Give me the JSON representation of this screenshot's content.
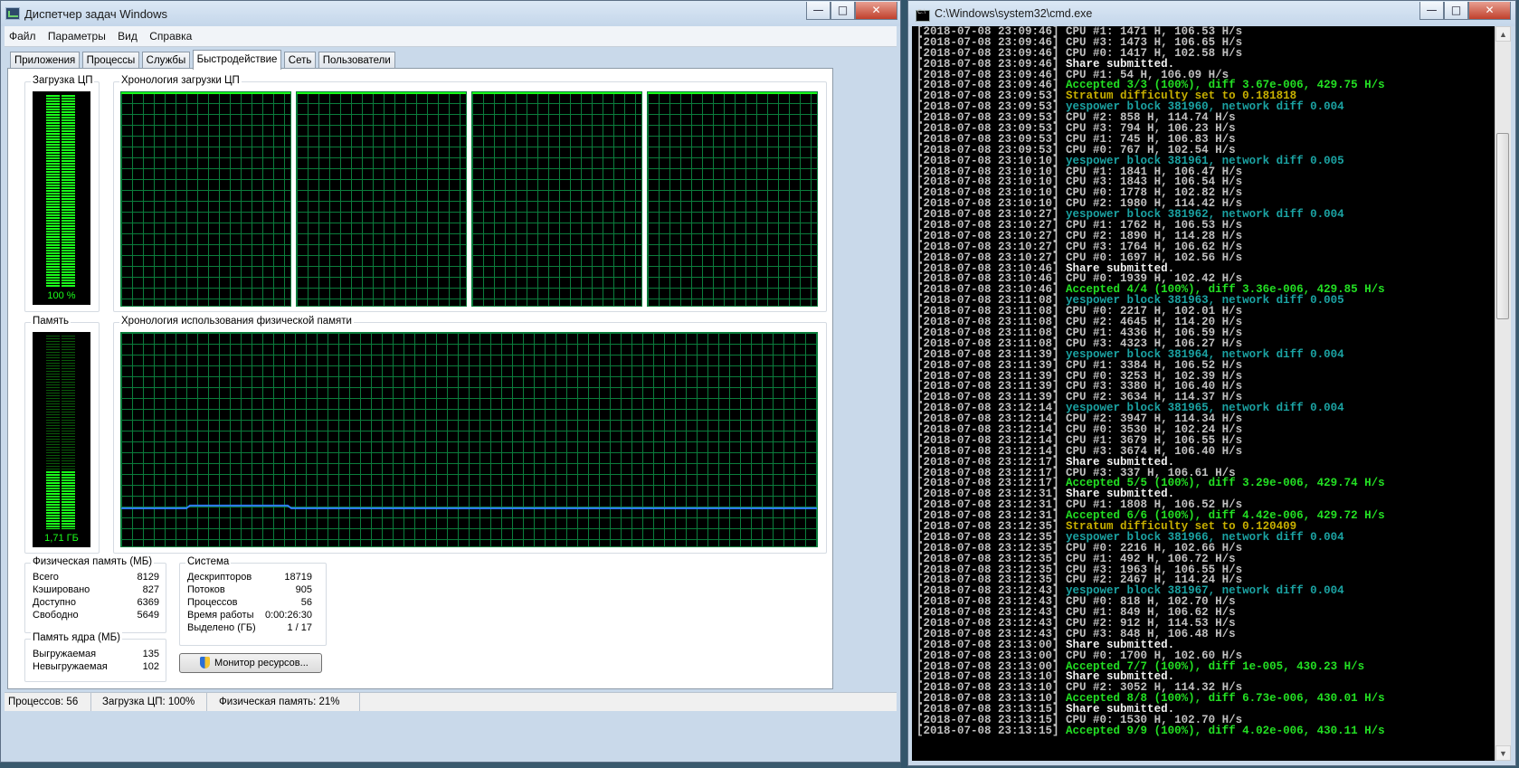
{
  "taskmanager": {
    "title": "Диспетчер задач Windows",
    "controls": {
      "minimize": "—",
      "maximize": "□",
      "close": "✕"
    },
    "menu": [
      "Файл",
      "Параметры",
      "Вид",
      "Справка"
    ],
    "tabs": [
      "Приложения",
      "Процессы",
      "Службы",
      "Быстродействие",
      "Сеть",
      "Пользователи"
    ],
    "active_tab": "Быстродействие",
    "cpu_usage": {
      "label": "Загрузка ЦП",
      "value_text": "100 %",
      "level": 1.0
    },
    "cpu_history": {
      "label": "Хронология загрузки ЦП",
      "cores": 4,
      "values_percent": [
        100,
        100,
        100,
        100
      ]
    },
    "memory": {
      "label": "Память",
      "value_text": "1,71 ГБ",
      "level": 0.21
    },
    "memory_history": {
      "label": "Хронология использования физической памяти",
      "level_percent": 21
    },
    "physical_memory": {
      "title": "Физическая память (МБ)",
      "rows": [
        {
          "label": "Всего",
          "value": "8129"
        },
        {
          "label": "Кэшировано",
          "value": "827"
        },
        {
          "label": "Доступно",
          "value": "6369"
        },
        {
          "label": "Свободно",
          "value": "5649"
        }
      ]
    },
    "kernel_memory": {
      "title": "Память ядра (МБ)",
      "rows": [
        {
          "label": "Выгружаемая",
          "value": "135"
        },
        {
          "label": "Невыгружаемая",
          "value": "102"
        }
      ]
    },
    "system": {
      "title": "Система",
      "rows": [
        {
          "label": "Дескрипторов",
          "value": "18719"
        },
        {
          "label": "Потоков",
          "value": "905"
        },
        {
          "label": "Процессов",
          "value": "56"
        },
        {
          "label": "Время работы",
          "value": "0:00:26:30"
        },
        {
          "label": "Выделено (ГБ)",
          "value": "1 / 17"
        }
      ]
    },
    "resource_monitor_button": "Монитор ресурсов...",
    "statusbar": {
      "processes": "Процессов: 56",
      "cpu": "Загрузка ЦП: 100%",
      "memory": "Физическая память: 21%"
    }
  },
  "cmd": {
    "title": "C:\\Windows\\system32\\cmd.exe",
    "lines": [
      {
        "ts": "[2018-07-08 23:09:46]",
        "msg": "CPU #1: 1471 H, 106.53 H/s",
        "type": "normal"
      },
      {
        "ts": "[2018-07-08 23:09:46]",
        "msg": "CPU #3: 1473 H, 106.65 H/s",
        "type": "normal"
      },
      {
        "ts": "[2018-07-08 23:09:46]",
        "msg": "CPU #0: 1417 H, 102.58 H/s",
        "type": "normal"
      },
      {
        "ts": "[2018-07-08 23:09:46]",
        "msg": "Share submitted.",
        "type": "white"
      },
      {
        "ts": "[2018-07-08 23:09:46]",
        "msg": "CPU #1: 54 H, 106.09 H/s",
        "type": "normal"
      },
      {
        "ts": "[2018-07-08 23:09:46]",
        "msg": "Accepted 3/3 (100%), diff 3.67e-006, 429.75 H/s",
        "type": "accepted"
      },
      {
        "ts": "[2018-07-08 23:09:53]",
        "msg": "Stratum difficulty set to 0.181818",
        "type": "stratum"
      },
      {
        "ts": "[2018-07-08 23:09:53]",
        "msg": "yespower block 381960, network diff 0.004",
        "type": "block"
      },
      {
        "ts": "[2018-07-08 23:09:53]",
        "msg": "CPU #2: 858 H, 114.74 H/s",
        "type": "normal"
      },
      {
        "ts": "[2018-07-08 23:09:53]",
        "msg": "CPU #3: 794 H, 106.23 H/s",
        "type": "normal"
      },
      {
        "ts": "[2018-07-08 23:09:53]",
        "msg": "CPU #1: 745 H, 106.83 H/s",
        "type": "normal"
      },
      {
        "ts": "[2018-07-08 23:09:53]",
        "msg": "CPU #0: 767 H, 102.54 H/s",
        "type": "normal"
      },
      {
        "ts": "[2018-07-08 23:10:10]",
        "msg": "yespower block 381961, network diff 0.005",
        "type": "block"
      },
      {
        "ts": "[2018-07-08 23:10:10]",
        "msg": "CPU #1: 1841 H, 106.47 H/s",
        "type": "normal"
      },
      {
        "ts": "[2018-07-08 23:10:10]",
        "msg": "CPU #3: 1843 H, 106.54 H/s",
        "type": "normal"
      },
      {
        "ts": "[2018-07-08 23:10:10]",
        "msg": "CPU #0: 1778 H, 102.82 H/s",
        "type": "normal"
      },
      {
        "ts": "[2018-07-08 23:10:10]",
        "msg": "CPU #2: 1980 H, 114.42 H/s",
        "type": "normal"
      },
      {
        "ts": "[2018-07-08 23:10:27]",
        "msg": "yespower block 381962, network diff 0.004",
        "type": "block"
      },
      {
        "ts": "[2018-07-08 23:10:27]",
        "msg": "CPU #1: 1762 H, 106.53 H/s",
        "type": "normal"
      },
      {
        "ts": "[2018-07-08 23:10:27]",
        "msg": "CPU #2: 1890 H, 114.28 H/s",
        "type": "normal"
      },
      {
        "ts": "[2018-07-08 23:10:27]",
        "msg": "CPU #3: 1764 H, 106.62 H/s",
        "type": "normal"
      },
      {
        "ts": "[2018-07-08 23:10:27]",
        "msg": "CPU #0: 1697 H, 102.56 H/s",
        "type": "normal"
      },
      {
        "ts": "[2018-07-08 23:10:46]",
        "msg": "Share submitted.",
        "type": "white"
      },
      {
        "ts": "[2018-07-08 23:10:46]",
        "msg": "CPU #0: 1939 H, 102.42 H/s",
        "type": "normal"
      },
      {
        "ts": "[2018-07-08 23:10:46]",
        "msg": "Accepted 4/4 (100%), diff 3.36e-006, 429.85 H/s",
        "type": "accepted"
      },
      {
        "ts": "[2018-07-08 23:11:08]",
        "msg": "yespower block 381963, network diff 0.005",
        "type": "block"
      },
      {
        "ts": "[2018-07-08 23:11:08]",
        "msg": "CPU #0: 2217 H, 102.01 H/s",
        "type": "normal"
      },
      {
        "ts": "[2018-07-08 23:11:08]",
        "msg": "CPU #2: 4645 H, 114.20 H/s",
        "type": "normal"
      },
      {
        "ts": "[2018-07-08 23:11:08]",
        "msg": "CPU #1: 4336 H, 106.59 H/s",
        "type": "normal"
      },
      {
        "ts": "[2018-07-08 23:11:08]",
        "msg": "CPU #3: 4323 H, 106.27 H/s",
        "type": "normal"
      },
      {
        "ts": "[2018-07-08 23:11:39]",
        "msg": "yespower block 381964, network diff 0.004",
        "type": "block"
      },
      {
        "ts": "[2018-07-08 23:11:39]",
        "msg": "CPU #1: 3384 H, 106.52 H/s",
        "type": "normal"
      },
      {
        "ts": "[2018-07-08 23:11:39]",
        "msg": "CPU #0: 3253 H, 102.39 H/s",
        "type": "normal"
      },
      {
        "ts": "[2018-07-08 23:11:39]",
        "msg": "CPU #3: 3380 H, 106.40 H/s",
        "type": "normal"
      },
      {
        "ts": "[2018-07-08 23:11:39]",
        "msg": "CPU #2: 3634 H, 114.37 H/s",
        "type": "normal"
      },
      {
        "ts": "[2018-07-08 23:12:14]",
        "msg": "yespower block 381965, network diff 0.004",
        "type": "block"
      },
      {
        "ts": "[2018-07-08 23:12:14]",
        "msg": "CPU #2: 3947 H, 114.34 H/s",
        "type": "normal"
      },
      {
        "ts": "[2018-07-08 23:12:14]",
        "msg": "CPU #0: 3530 H, 102.24 H/s",
        "type": "normal"
      },
      {
        "ts": "[2018-07-08 23:12:14]",
        "msg": "CPU #1: 3679 H, 106.55 H/s",
        "type": "normal"
      },
      {
        "ts": "[2018-07-08 23:12:14]",
        "msg": "CPU #3: 3674 H, 106.40 H/s",
        "type": "normal"
      },
      {
        "ts": "[2018-07-08 23:12:17]",
        "msg": "Share submitted.",
        "type": "white"
      },
      {
        "ts": "[2018-07-08 23:12:17]",
        "msg": "CPU #3: 337 H, 106.61 H/s",
        "type": "normal"
      },
      {
        "ts": "[2018-07-08 23:12:17]",
        "msg": "Accepted 5/5 (100%), diff 3.29e-006, 429.74 H/s",
        "type": "accepted"
      },
      {
        "ts": "[2018-07-08 23:12:31]",
        "msg": "Share submitted.",
        "type": "white"
      },
      {
        "ts": "[2018-07-08 23:12:31]",
        "msg": "CPU #1: 1808 H, 106.52 H/s",
        "type": "normal"
      },
      {
        "ts": "[2018-07-08 23:12:31]",
        "msg": "Accepted 6/6 (100%), diff 4.42e-006, 429.72 H/s",
        "type": "accepted"
      },
      {
        "ts": "[2018-07-08 23:12:35]",
        "msg": "Stratum difficulty set to 0.120409",
        "type": "stratum"
      },
      {
        "ts": "[2018-07-08 23:12:35]",
        "msg": "yespower block 381966, network diff 0.004",
        "type": "block"
      },
      {
        "ts": "[2018-07-08 23:12:35]",
        "msg": "CPU #0: 2216 H, 102.66 H/s",
        "type": "normal"
      },
      {
        "ts": "[2018-07-08 23:12:35]",
        "msg": "CPU #1: 492 H, 106.72 H/s",
        "type": "normal"
      },
      {
        "ts": "[2018-07-08 23:12:35]",
        "msg": "CPU #3: 1963 H, 106.55 H/s",
        "type": "normal"
      },
      {
        "ts": "[2018-07-08 23:12:35]",
        "msg": "CPU #2: 2467 H, 114.24 H/s",
        "type": "normal"
      },
      {
        "ts": "[2018-07-08 23:12:43]",
        "msg": "yespower block 381967, network diff 0.004",
        "type": "block"
      },
      {
        "ts": "[2018-07-08 23:12:43]",
        "msg": "CPU #0: 818 H, 102.70 H/s",
        "type": "normal"
      },
      {
        "ts": "[2018-07-08 23:12:43]",
        "msg": "CPU #1: 849 H, 106.62 H/s",
        "type": "normal"
      },
      {
        "ts": "[2018-07-08 23:12:43]",
        "msg": "CPU #2: 912 H, 114.53 H/s",
        "type": "normal"
      },
      {
        "ts": "[2018-07-08 23:12:43]",
        "msg": "CPU #3: 848 H, 106.48 H/s",
        "type": "normal"
      },
      {
        "ts": "[2018-07-08 23:13:00]",
        "msg": "Share submitted.",
        "type": "white"
      },
      {
        "ts": "[2018-07-08 23:13:00]",
        "msg": "CPU #0: 1700 H, 102.60 H/s",
        "type": "normal"
      },
      {
        "ts": "[2018-07-08 23:13:00]",
        "msg": "Accepted 7/7 (100%), diff 1e-005, 430.23 H/s",
        "type": "accepted"
      },
      {
        "ts": "[2018-07-08 23:13:10]",
        "msg": "Share submitted.",
        "type": "white"
      },
      {
        "ts": "[2018-07-08 23:13:10]",
        "msg": "CPU #2: 3052 H, 114.32 H/s",
        "type": "normal"
      },
      {
        "ts": "[2018-07-08 23:13:10]",
        "msg": "Accepted 8/8 (100%), diff 6.73e-006, 430.01 H/s",
        "type": "accepted"
      },
      {
        "ts": "[2018-07-08 23:13:15]",
        "msg": "Share submitted.",
        "type": "white"
      },
      {
        "ts": "[2018-07-08 23:13:15]",
        "msg": "CPU #0: 1530 H, 102.70 H/s",
        "type": "normal"
      },
      {
        "ts": "[2018-07-08 23:13:15]",
        "msg": "Accepted 9/9 (100%), diff 4.02e-006, 430.11 H/s",
        "type": "accepted"
      }
    ]
  },
  "colors": {
    "graph_grid": "#0b7d3c",
    "graph_line": "#1aff1a",
    "memory_line": "#2f7fff",
    "accepted": "#23e023",
    "stratum": "#c8b000",
    "block": "#1ba3a3"
  }
}
